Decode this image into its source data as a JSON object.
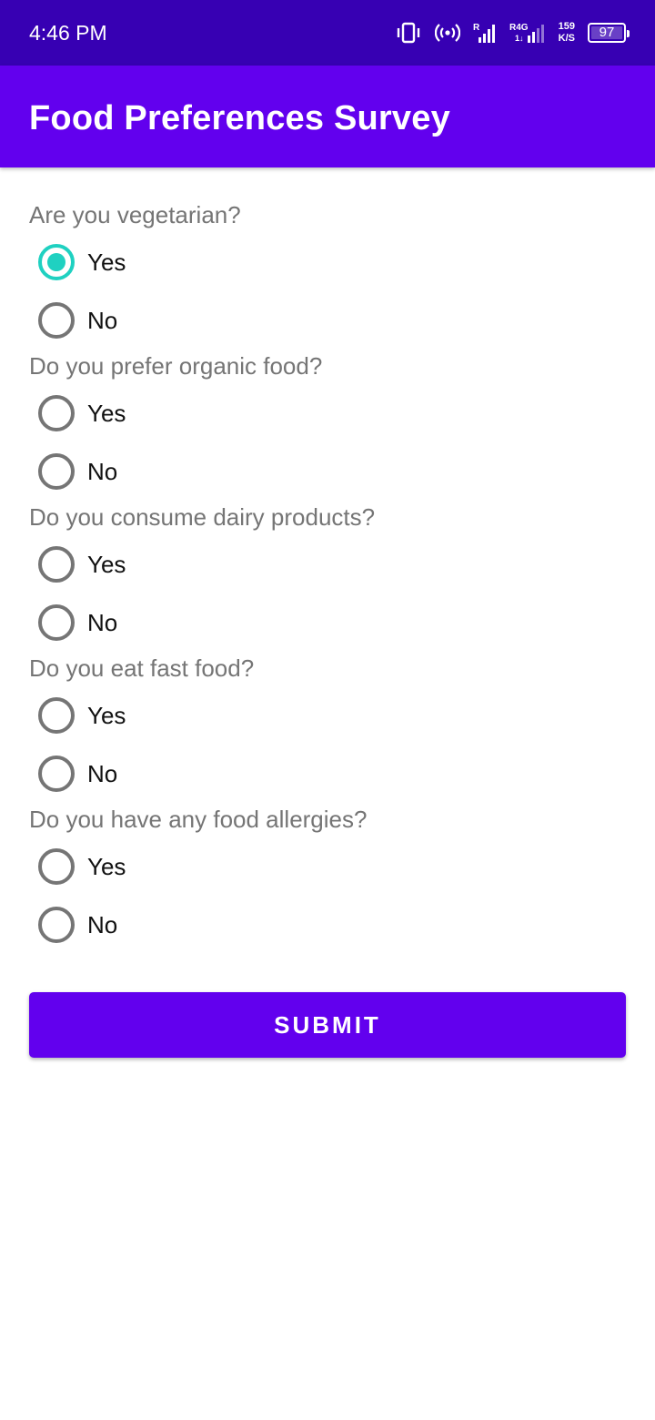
{
  "status_bar": {
    "time": "4:46 PM",
    "network_speed_value": "159",
    "network_speed_unit": "K/S",
    "battery_level": "97",
    "icons": [
      "vibrate-icon",
      "hotspot-icon",
      "signal-r-icon",
      "signal-r4g-icon",
      "battery-icon"
    ]
  },
  "app_bar": {
    "title": "Food Preferences Survey"
  },
  "questions": [
    {
      "label": "Are you vegetarian?",
      "options": [
        "Yes",
        "No"
      ],
      "selected": "Yes"
    },
    {
      "label": "Do you prefer organic food?",
      "options": [
        "Yes",
        "No"
      ],
      "selected": null
    },
    {
      "label": "Do you consume dairy products?",
      "options": [
        "Yes",
        "No"
      ],
      "selected": null
    },
    {
      "label": "Do you eat fast food?",
      "options": [
        "Yes",
        "No"
      ],
      "selected": null
    },
    {
      "label": "Do you have any food allergies?",
      "options": [
        "Yes",
        "No"
      ],
      "selected": null
    }
  ],
  "submit": {
    "label": "SUBMIT"
  },
  "colors": {
    "status_bar": "#3700b3",
    "primary": "#6200ee",
    "radio_checked": "#1fd1c1",
    "radio_unchecked": "#757575",
    "question_text": "#757575"
  }
}
